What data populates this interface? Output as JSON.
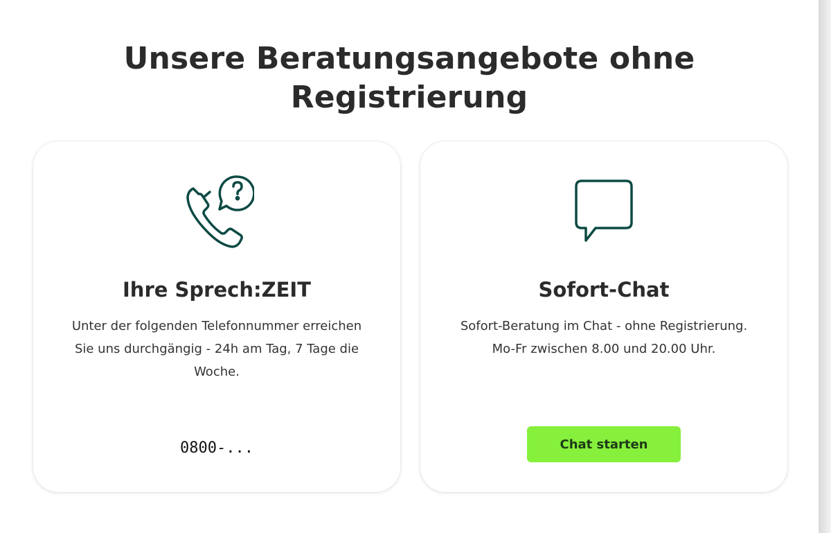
{
  "heading": {
    "line1": "Unsere Beratungsangebote ohne",
    "line2": "Registrierung"
  },
  "theme": {
    "icon_color": "#0e4a44",
    "button_color": "#86f03c",
    "text_color": "#2b2b2b"
  },
  "cards": [
    {
      "icon": "phone-question-icon",
      "title": "Ihre Sprech:ZEIT",
      "text": "Unter der folgenden Telefonnummer erreichen Sie uns durchgängig - 24h am Tag, 7 Tage die Woche.",
      "phone": "0800-..."
    },
    {
      "icon": "chat-bubble-icon",
      "title": "Sofort-Chat",
      "text": "Sofort-Beratung im Chat - ohne Registrierung. Mo-Fr zwischen 8.00 und 20.00 Uhr.",
      "button_label": "Chat starten"
    }
  ]
}
